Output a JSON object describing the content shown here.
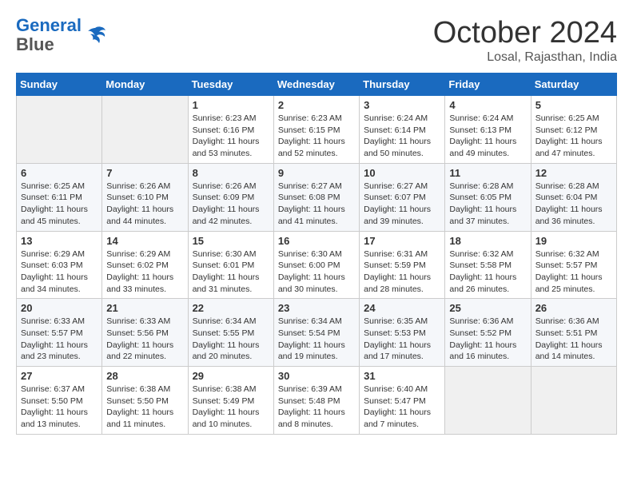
{
  "logo": {
    "line1": "General",
    "line2": "Blue"
  },
  "title": "October 2024",
  "location": "Losal, Rajasthan, India",
  "weekdays": [
    "Sunday",
    "Monday",
    "Tuesday",
    "Wednesday",
    "Thursday",
    "Friday",
    "Saturday"
  ],
  "weeks": [
    [
      {
        "day": "",
        "info": ""
      },
      {
        "day": "",
        "info": ""
      },
      {
        "day": "1",
        "info": "Sunrise: 6:23 AM\nSunset: 6:16 PM\nDaylight: 11 hours and 53 minutes."
      },
      {
        "day": "2",
        "info": "Sunrise: 6:23 AM\nSunset: 6:15 PM\nDaylight: 11 hours and 52 minutes."
      },
      {
        "day": "3",
        "info": "Sunrise: 6:24 AM\nSunset: 6:14 PM\nDaylight: 11 hours and 50 minutes."
      },
      {
        "day": "4",
        "info": "Sunrise: 6:24 AM\nSunset: 6:13 PM\nDaylight: 11 hours and 49 minutes."
      },
      {
        "day": "5",
        "info": "Sunrise: 6:25 AM\nSunset: 6:12 PM\nDaylight: 11 hours and 47 minutes."
      }
    ],
    [
      {
        "day": "6",
        "info": "Sunrise: 6:25 AM\nSunset: 6:11 PM\nDaylight: 11 hours and 45 minutes."
      },
      {
        "day": "7",
        "info": "Sunrise: 6:26 AM\nSunset: 6:10 PM\nDaylight: 11 hours and 44 minutes."
      },
      {
        "day": "8",
        "info": "Sunrise: 6:26 AM\nSunset: 6:09 PM\nDaylight: 11 hours and 42 minutes."
      },
      {
        "day": "9",
        "info": "Sunrise: 6:27 AM\nSunset: 6:08 PM\nDaylight: 11 hours and 41 minutes."
      },
      {
        "day": "10",
        "info": "Sunrise: 6:27 AM\nSunset: 6:07 PM\nDaylight: 11 hours and 39 minutes."
      },
      {
        "day": "11",
        "info": "Sunrise: 6:28 AM\nSunset: 6:05 PM\nDaylight: 11 hours and 37 minutes."
      },
      {
        "day": "12",
        "info": "Sunrise: 6:28 AM\nSunset: 6:04 PM\nDaylight: 11 hours and 36 minutes."
      }
    ],
    [
      {
        "day": "13",
        "info": "Sunrise: 6:29 AM\nSunset: 6:03 PM\nDaylight: 11 hours and 34 minutes."
      },
      {
        "day": "14",
        "info": "Sunrise: 6:29 AM\nSunset: 6:02 PM\nDaylight: 11 hours and 33 minutes."
      },
      {
        "day": "15",
        "info": "Sunrise: 6:30 AM\nSunset: 6:01 PM\nDaylight: 11 hours and 31 minutes."
      },
      {
        "day": "16",
        "info": "Sunrise: 6:30 AM\nSunset: 6:00 PM\nDaylight: 11 hours and 30 minutes."
      },
      {
        "day": "17",
        "info": "Sunrise: 6:31 AM\nSunset: 5:59 PM\nDaylight: 11 hours and 28 minutes."
      },
      {
        "day": "18",
        "info": "Sunrise: 6:32 AM\nSunset: 5:58 PM\nDaylight: 11 hours and 26 minutes."
      },
      {
        "day": "19",
        "info": "Sunrise: 6:32 AM\nSunset: 5:57 PM\nDaylight: 11 hours and 25 minutes."
      }
    ],
    [
      {
        "day": "20",
        "info": "Sunrise: 6:33 AM\nSunset: 5:57 PM\nDaylight: 11 hours and 23 minutes."
      },
      {
        "day": "21",
        "info": "Sunrise: 6:33 AM\nSunset: 5:56 PM\nDaylight: 11 hours and 22 minutes."
      },
      {
        "day": "22",
        "info": "Sunrise: 6:34 AM\nSunset: 5:55 PM\nDaylight: 11 hours and 20 minutes."
      },
      {
        "day": "23",
        "info": "Sunrise: 6:34 AM\nSunset: 5:54 PM\nDaylight: 11 hours and 19 minutes."
      },
      {
        "day": "24",
        "info": "Sunrise: 6:35 AM\nSunset: 5:53 PM\nDaylight: 11 hours and 17 minutes."
      },
      {
        "day": "25",
        "info": "Sunrise: 6:36 AM\nSunset: 5:52 PM\nDaylight: 11 hours and 16 minutes."
      },
      {
        "day": "26",
        "info": "Sunrise: 6:36 AM\nSunset: 5:51 PM\nDaylight: 11 hours and 14 minutes."
      }
    ],
    [
      {
        "day": "27",
        "info": "Sunrise: 6:37 AM\nSunset: 5:50 PM\nDaylight: 11 hours and 13 minutes."
      },
      {
        "day": "28",
        "info": "Sunrise: 6:38 AM\nSunset: 5:50 PM\nDaylight: 11 hours and 11 minutes."
      },
      {
        "day": "29",
        "info": "Sunrise: 6:38 AM\nSunset: 5:49 PM\nDaylight: 11 hours and 10 minutes."
      },
      {
        "day": "30",
        "info": "Sunrise: 6:39 AM\nSunset: 5:48 PM\nDaylight: 11 hours and 8 minutes."
      },
      {
        "day": "31",
        "info": "Sunrise: 6:40 AM\nSunset: 5:47 PM\nDaylight: 11 hours and 7 minutes."
      },
      {
        "day": "",
        "info": ""
      },
      {
        "day": "",
        "info": ""
      }
    ]
  ]
}
